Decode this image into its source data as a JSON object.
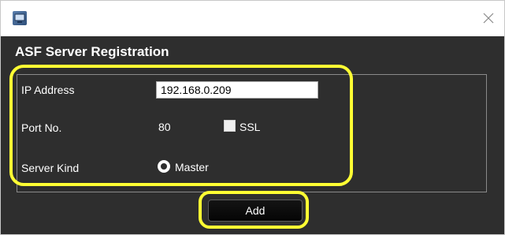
{
  "window": {
    "icon": "app-icon",
    "close_icon": "close-icon"
  },
  "dialog": {
    "title": "ASF Server Registration"
  },
  "fields": {
    "ip_label": "IP Address",
    "ip_value": "192.168.0.209",
    "port_label": "Port No.",
    "port_value": "80",
    "ssl_label": "SSL",
    "ssl_checked": false,
    "server_kind_label": "Server Kind",
    "server_kind_option": "Master",
    "server_kind_selected": true
  },
  "actions": {
    "add_label": "Add"
  },
  "colors": {
    "dialog_bg": "#2e2e2e",
    "highlight": "#ffff33",
    "text": "#ffffff"
  }
}
